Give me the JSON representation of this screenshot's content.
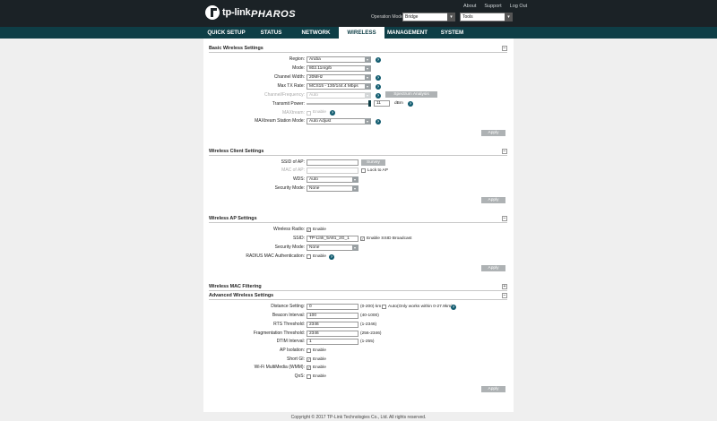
{
  "brand": {
    "logo_text": "tp-link",
    "product": "PHAROS"
  },
  "header": {
    "links": [
      "About",
      "Support",
      "Log Out"
    ],
    "operation_mode_label": "Operation Mode:",
    "operation_mode_value": "Bridge",
    "tools_value": "Tools"
  },
  "nav": {
    "items": [
      "QUICK SETUP",
      "STATUS",
      "NETWORK",
      "WIRELESS",
      "MANAGEMENT",
      "SYSTEM"
    ],
    "active": "WIRELESS"
  },
  "basic": {
    "title": "Basic Wireless Settings",
    "region_label": "Region:",
    "region_value": "Aruba",
    "mode_label": "Mode:",
    "mode_value": "802.11n/g/b",
    "width_label": "Channel Width:",
    "width_value": "20MHz",
    "rate_label": "Max TX Rate:",
    "rate_value": "MCS15 - 130/144.4 Mbps",
    "channel_label": "Channel/Frequency:",
    "channel_value": "Auto",
    "spectrum_button": "Spectrum Analysis",
    "power_label": "Transmit Power:",
    "power_value": "11",
    "power_unit": "dBm",
    "power_fraction": 1.0,
    "maxtream_label": "MAXtream:",
    "maxtream_option": "Enable",
    "station_label": "MAXtream Station Mode:",
    "station_value": "Auto Adjust",
    "apply": "Apply"
  },
  "client": {
    "title": "Wireless Client Settings",
    "ssid_label": "SSID of AP:",
    "ssid_value": "",
    "survey_button": "Survey",
    "mac_label": "MAC of AP:",
    "mac_value": "",
    "lock_label": "Lock to AP",
    "wds_label": "WDS:",
    "wds_value": "Auto",
    "security_label": "Security Mode:",
    "security_value": "None",
    "apply": "Apply"
  },
  "ap": {
    "title": "Wireless AP Settings",
    "radio_label": "Wireless Radio:",
    "radio_option": "Enable",
    "ssid_label": "SSID:",
    "ssid_value": "TP-Link_5A81_2G_1",
    "broadcast_option": "Enable SSID Broadcast",
    "security_label": "Security Mode:",
    "security_value": "None",
    "radius_label": "RADIUS MAC Authentication:",
    "radius_option": "Enable",
    "apply": "Apply"
  },
  "mac_filtering": {
    "title": "Wireless MAC Filtering"
  },
  "advanced": {
    "title": "Advanced Wireless Settings",
    "distance_label": "Distance Setting:",
    "distance_value": "0",
    "distance_hint": "(0-200) km",
    "auto_label": "Auto",
    "auto_hint": "(Only works within 0-27.9km)",
    "beacon_label": "Beacon Interval:",
    "beacon_value": "100",
    "beacon_hint": "(40-1000)",
    "rts_label": "RTS Threshold:",
    "rts_value": "2346",
    "rts_hint": "(1-2346)",
    "frag_label": "Fragmentation Threshold:",
    "frag_value": "2346",
    "frag_hint": "(256-2346)",
    "dtim_label": "DTIM Interval:",
    "dtim_value": "1",
    "dtim_hint": "(1-255)",
    "isolation_label": "AP Isolation:",
    "isolation_option": "Enable",
    "shortgi_label": "Short GI:",
    "shortgi_option": "Enable",
    "wmm_label": "Wi-Fi MultiMedia (WMM):",
    "wmm_option": "Enable",
    "qos_label": "QoS:",
    "qos_option": "Enable",
    "apply": "Apply"
  },
  "footer": {
    "copyright": "Copyright © 2017 TP-Link Technologies Co., Ltd. All rights reserved."
  },
  "colors": {
    "header": "#1b2226",
    "nav": "#0e3e46",
    "help": "#0f5a6e",
    "button": "#aeb2b4"
  }
}
